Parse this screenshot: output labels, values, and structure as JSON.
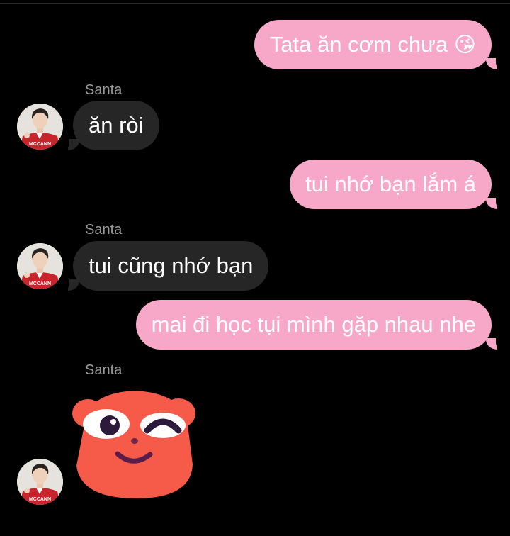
{
  "conversation": {
    "sender_name": "Santa",
    "messages": [
      {
        "from": "me",
        "text": "Tata ăn cơm chưa",
        "emoji": "😘"
      },
      {
        "from": "Santa",
        "text": "ăn ròi"
      },
      {
        "from": "me",
        "text": "tui nhớ bạn lắm á"
      },
      {
        "from": "Santa",
        "text": "tui cũng nhớ bạn"
      },
      {
        "from": "me",
        "text": "mai đi học tụi mình gặp nhau nhe"
      },
      {
        "from": "Santa",
        "type": "sticker",
        "sticker": "winking-red-bear"
      }
    ],
    "avatar_shirt_text": "MCCANN"
  },
  "colors": {
    "background": "#000000",
    "outgoing_bubble": "#f7a8c9",
    "incoming_bubble": "#262626",
    "sender_name": "#9a9a9a",
    "sticker_red": "#f65a48",
    "sticker_mouth": "#5a1d4a"
  }
}
